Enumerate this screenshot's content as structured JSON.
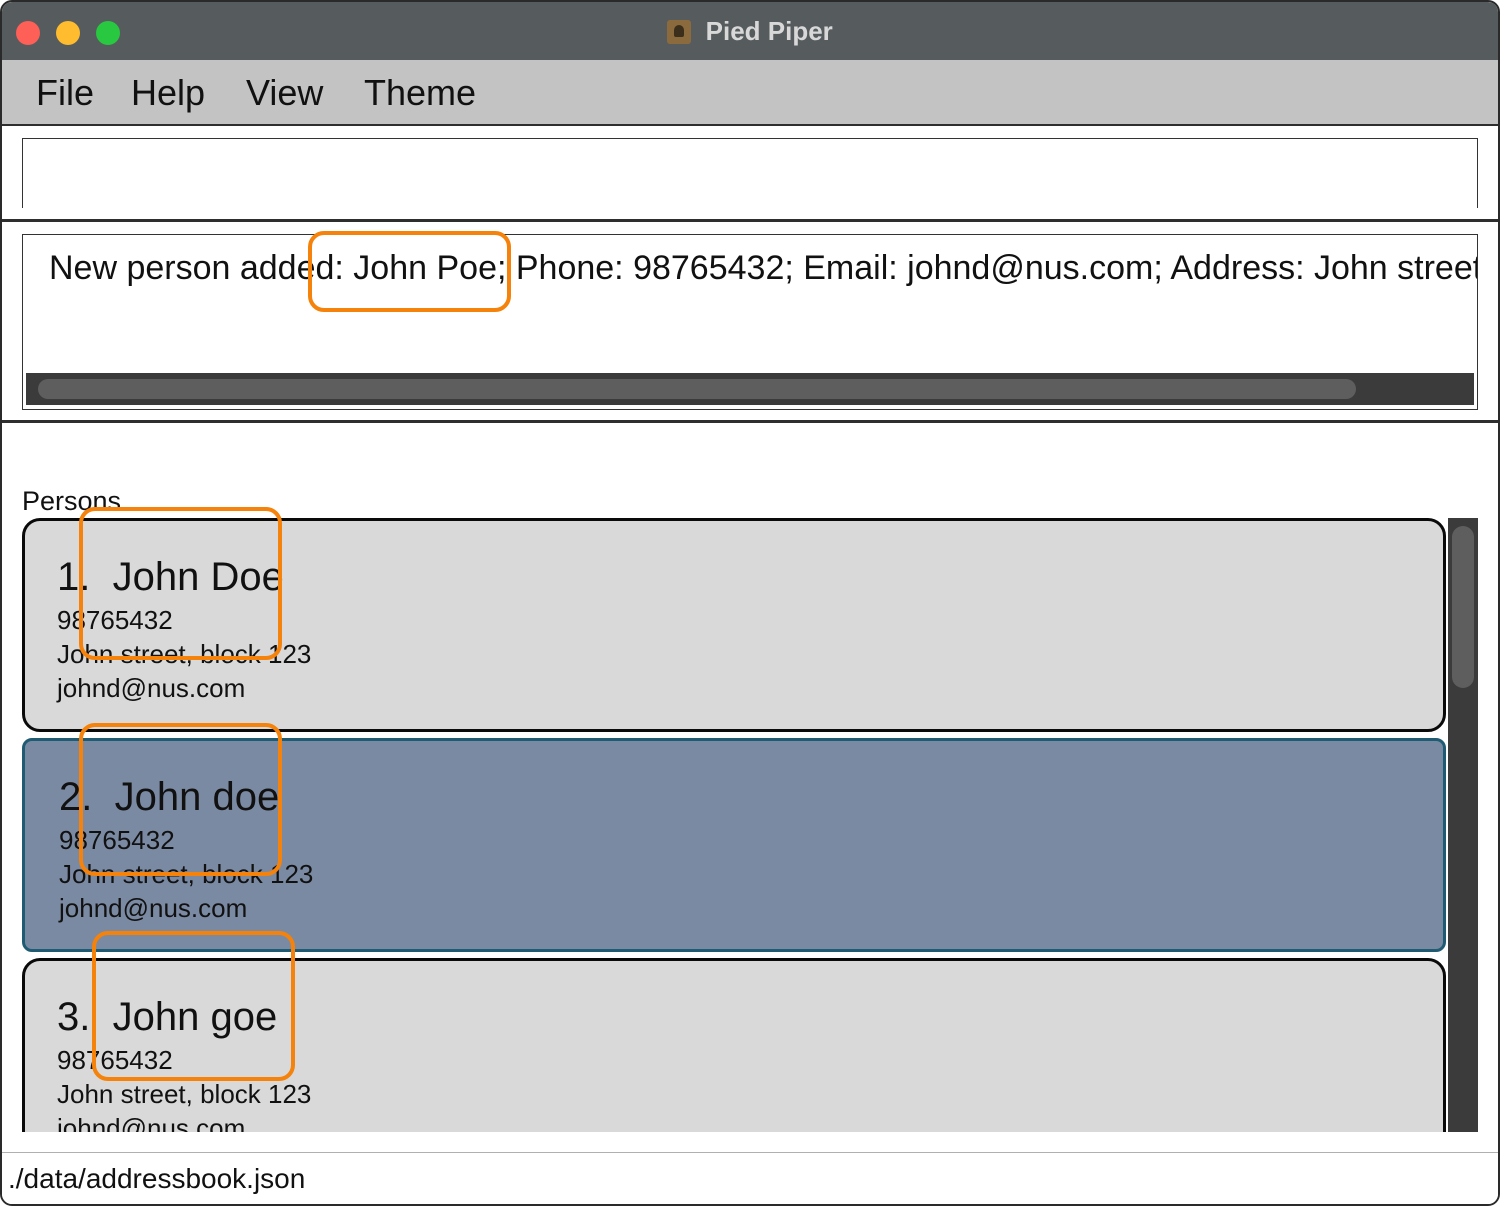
{
  "window": {
    "title": "Pied Piper"
  },
  "menu": [
    "File",
    "Help",
    "View",
    "Theme"
  ],
  "command_box": {
    "value": ""
  },
  "result": {
    "message": "New person added: John Poe; Phone: 98765432; Email: johnd@nus.com; Address: John street, blo"
  },
  "persons": {
    "label": "Persons",
    "items": [
      {
        "index": "1.",
        "name": "John Doe",
        "phone": "98765432",
        "address": "John street, block 123",
        "email": "johnd@nus.com",
        "selected": false
      },
      {
        "index": "2.",
        "name": "John doe",
        "phone": "98765432",
        "address": "John street, block 123",
        "email": "johnd@nus.com",
        "selected": true
      },
      {
        "index": "3.",
        "name": "John goe",
        "phone": "98765432",
        "address": "John street, block 123",
        "email": "johnd@nus.com",
        "selected": false
      }
    ]
  },
  "status_bar": {
    "path": "./data/addressbook.json"
  },
  "colors": {
    "highlight": "#f5820a",
    "selected_card": "#7b8aa3",
    "card": "#d9d9d9"
  }
}
